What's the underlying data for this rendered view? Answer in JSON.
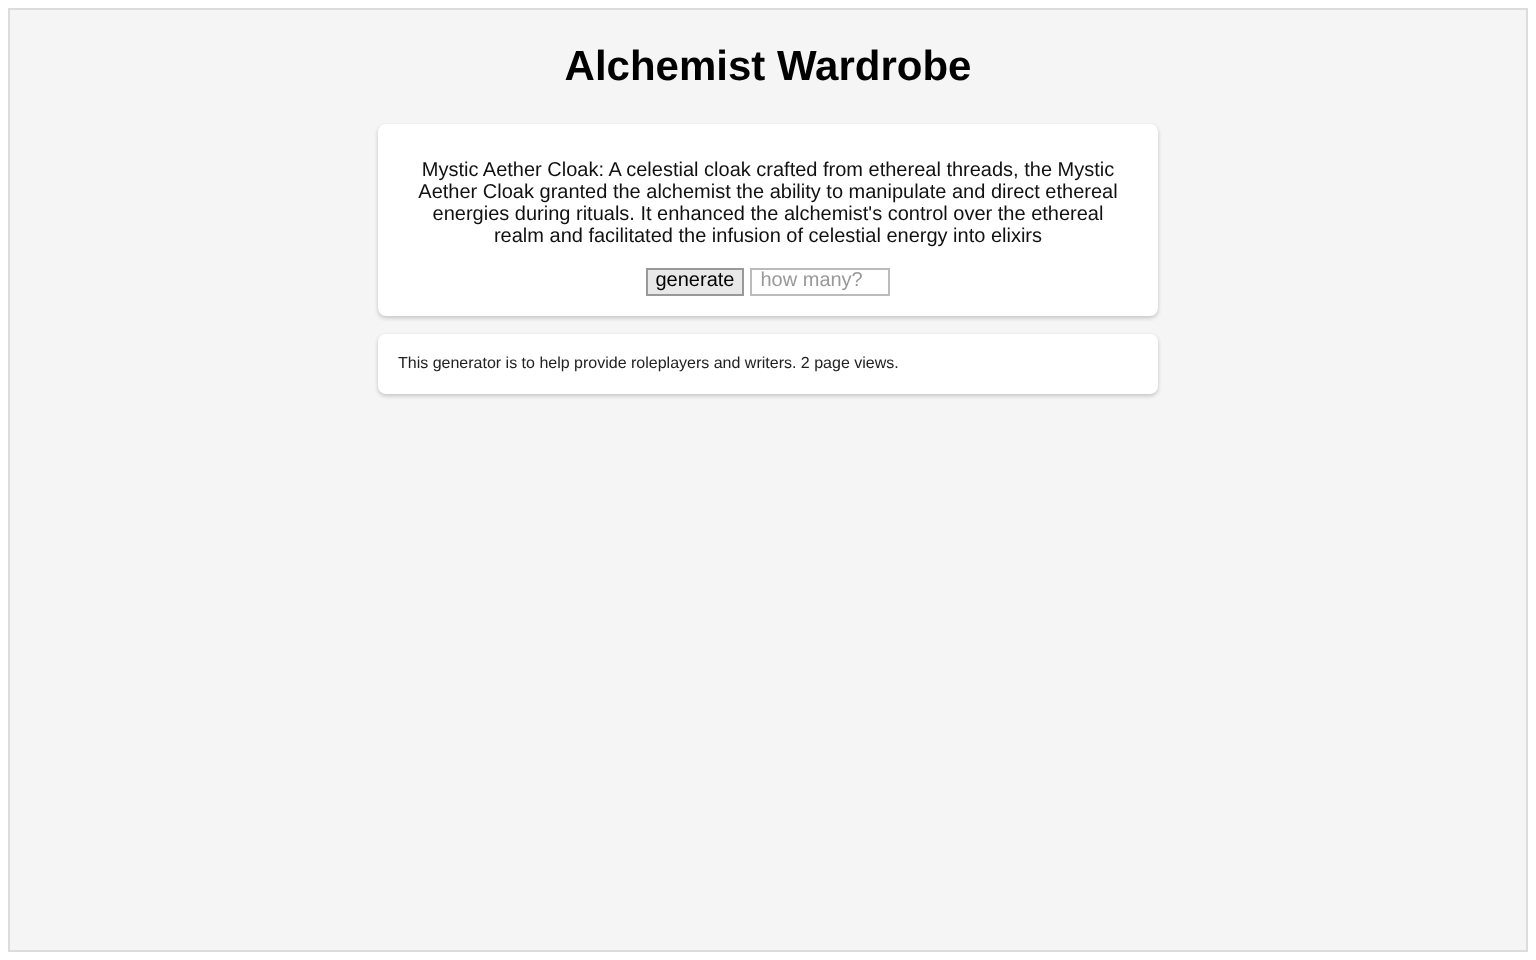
{
  "title": "Alchemist Wardrobe",
  "result": "Mystic Aether Cloak: A celestial cloak crafted from ethereal threads, the Mystic Aether Cloak granted the alchemist the ability to manipulate and direct ethereal energies during rituals. It enhanced the alchemist's control over the ethereal realm and facilitated the infusion of celestial energy into elixirs",
  "generate_button": "generate",
  "count_field": {
    "placeholder": "how many?"
  },
  "footer": "This generator is to help provide roleplayers and writers. 2 page views."
}
